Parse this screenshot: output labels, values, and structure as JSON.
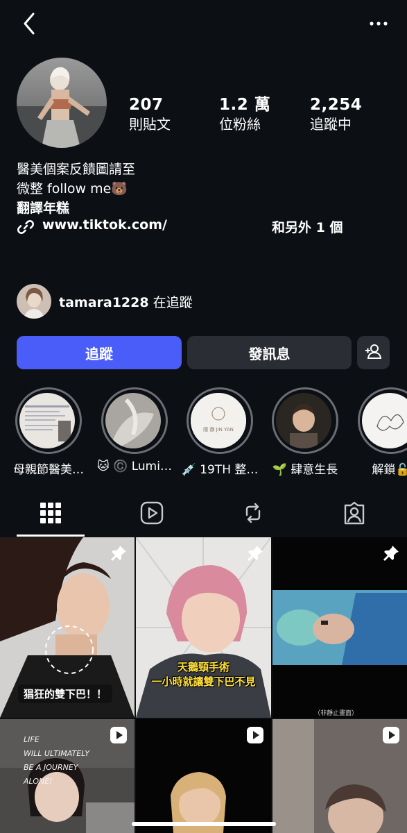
{
  "profile": {
    "stats": [
      {
        "value": "207",
        "label": "則貼文"
      },
      {
        "value": "1.2 萬",
        "label": "位粉絲"
      },
      {
        "value": "2,254",
        "label": "追蹤中"
      }
    ],
    "bio_line1": "醫美個案反饋圖請至",
    "bio_line2": "微整 follow me🐻",
    "bio_translate": "翻譯年糕",
    "link_url": "www.tiktok.com/",
    "link_others": "和另外 1 個"
  },
  "followed_by": {
    "username": "tamara1228",
    "suffix": " 在追蹤"
  },
  "buttons": {
    "follow": "追蹤",
    "message": "發訊息"
  },
  "highlights": [
    {
      "label": "母親節醫美…",
      "inner_text": ""
    },
    {
      "label": "🐱 ©️ Lumi…",
      "inner_text": ""
    },
    {
      "label": "💉 19TH 整…",
      "inner_text": "隱 靜 JIN YAN"
    },
    {
      "label": "🌱 肆意生長",
      "inner_text": ""
    },
    {
      "label": "解鎖🔓",
      "inner_text": ""
    }
  ],
  "posts": [
    {
      "caption": "猖狂的雙下巴！！"
    },
    {
      "caption_line1": "天鵝頸手術",
      "caption_line2": "一小時就讓雙下巴不見"
    },
    {
      "caption": "（非靜止畫面）"
    },
    {
      "caption_lines": [
        "LIFE",
        "WILL ULTIMATELY",
        "BE A JOURNEY",
        "ALONE!"
      ]
    },
    {},
    {}
  ],
  "icons": {
    "back": "chevron-left-icon",
    "more": "more-horizontal-icon",
    "link": "link-icon",
    "add_user": "add-user-icon",
    "grid": "grid-icon",
    "reels": "reels-icon",
    "reposts": "repost-icon",
    "tagged": "tagged-icon",
    "pin": "pin-icon",
    "reel_badge": "reel-badge-icon"
  },
  "colors": {
    "background": "#0c0f14",
    "follow_button": "#4a5df9",
    "secondary_button": "#2a2d33"
  }
}
